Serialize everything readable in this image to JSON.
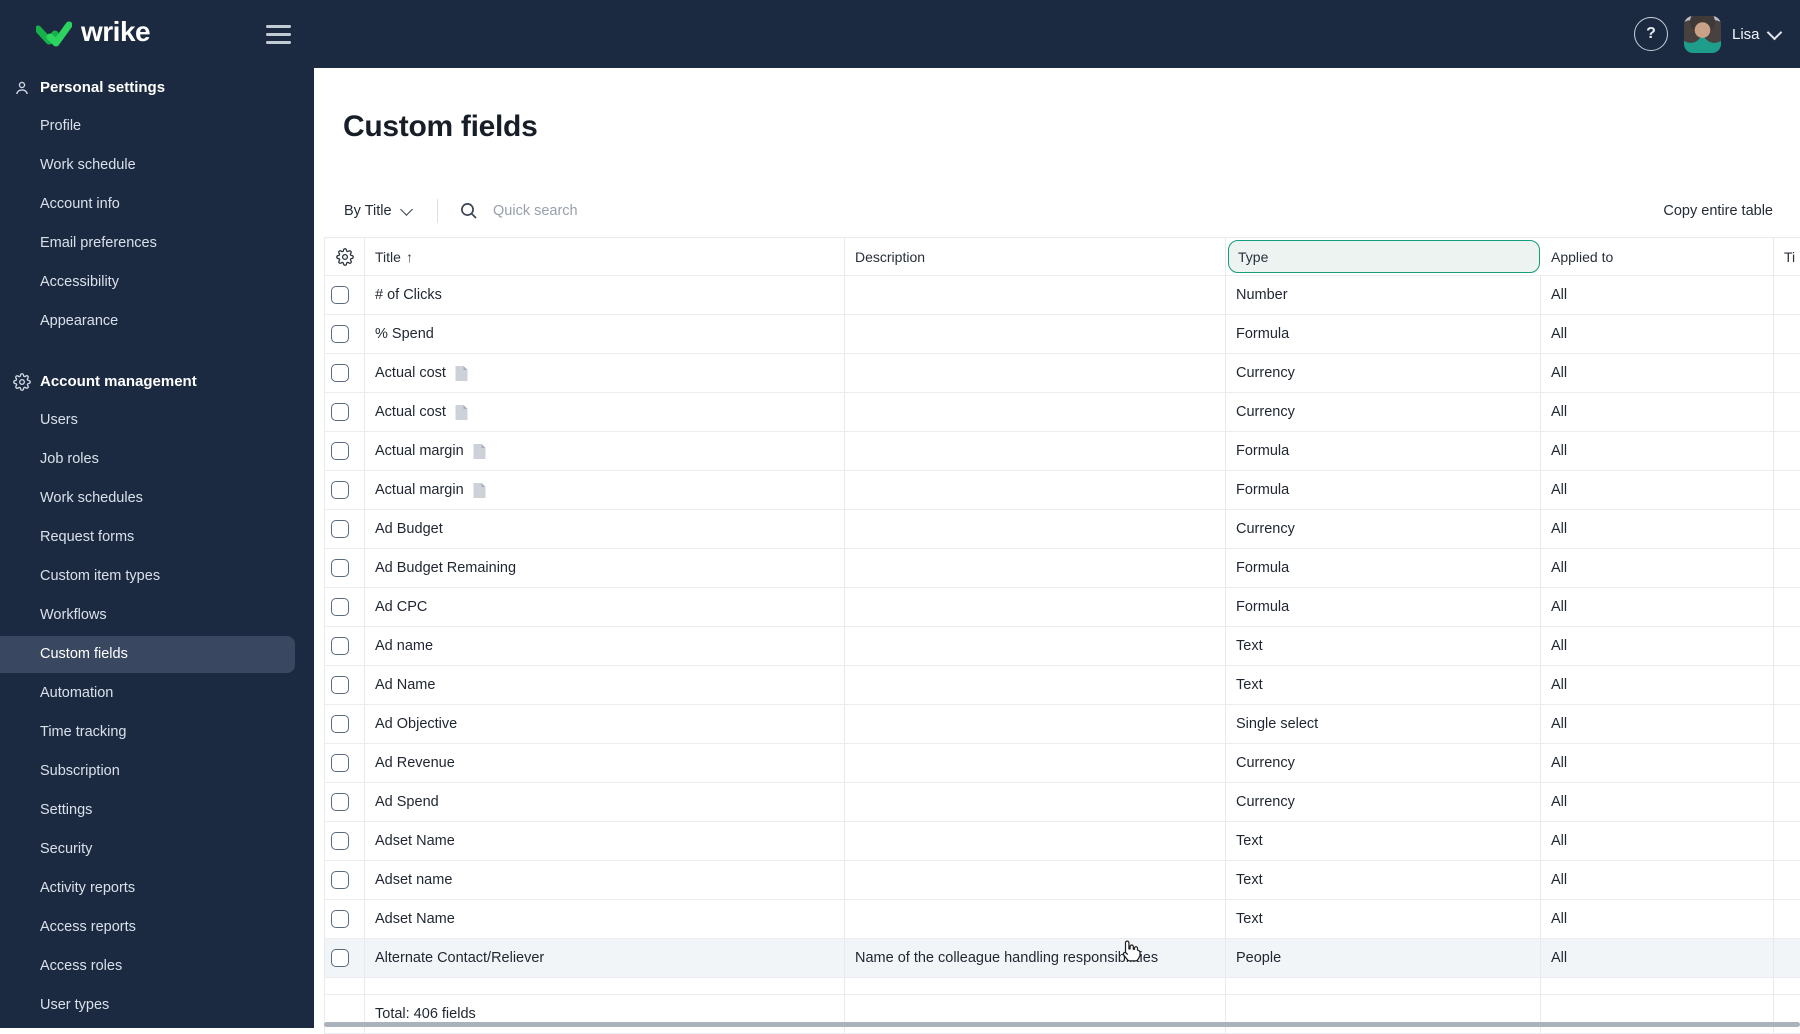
{
  "topbar": {
    "logo_text": "wrike",
    "help_glyph": "?",
    "user_name": "Lisa"
  },
  "icons": {
    "sort_asc": "↑"
  },
  "colors": {
    "topbar_bg": "#1b2a41",
    "sidebar_selected_bg": "#3a4760",
    "brand_green": "#21c95a",
    "type_highlight_border": "#149c7b",
    "type_highlight_bg": "#edf3f1",
    "hovered_row_bg": "#f1f5f8"
  },
  "sidebar": {
    "sections": [
      {
        "header": "Personal settings",
        "icon": "person-icon",
        "items": [
          {
            "label": "Profile",
            "selected": false
          },
          {
            "label": "Work schedule",
            "selected": false
          },
          {
            "label": "Account info",
            "selected": false
          },
          {
            "label": "Email preferences",
            "selected": false
          },
          {
            "label": "Accessibility",
            "selected": false
          },
          {
            "label": "Appearance",
            "selected": false
          }
        ]
      },
      {
        "header": "Account management",
        "icon": "gear-icon",
        "items": [
          {
            "label": "Users",
            "selected": false
          },
          {
            "label": "Job roles",
            "selected": false
          },
          {
            "label": "Work schedules",
            "selected": false
          },
          {
            "label": "Request forms",
            "selected": false
          },
          {
            "label": "Custom item types",
            "selected": false
          },
          {
            "label": "Workflows",
            "selected": false
          },
          {
            "label": "Custom fields",
            "selected": true
          },
          {
            "label": "Automation",
            "selected": false
          },
          {
            "label": "Time tracking",
            "selected": false
          },
          {
            "label": "Subscription",
            "selected": false
          },
          {
            "label": "Settings",
            "selected": false
          },
          {
            "label": "Security",
            "selected": false
          },
          {
            "label": "Activity reports",
            "selected": false
          },
          {
            "label": "Access reports",
            "selected": false
          },
          {
            "label": "Access roles",
            "selected": false
          },
          {
            "label": "User types",
            "selected": false
          }
        ]
      }
    ]
  },
  "main": {
    "title": "Custom fields",
    "toolbar": {
      "filter_label": "By Title",
      "search_placeholder": "Quick search",
      "copy_label": "Copy entire table"
    },
    "table": {
      "columns": [
        {
          "label": "Title",
          "sorted": "asc"
        },
        {
          "label": "Description"
        },
        {
          "label": "Type",
          "highlighted": true
        },
        {
          "label": "Applied to"
        },
        {
          "label": "Ti",
          "partial": true
        }
      ],
      "rows": [
        {
          "title": "# of Clicks",
          "description": "",
          "type": "Number",
          "applied_to": "All",
          "note_icon": false,
          "hovered": false
        },
        {
          "title": "% Spend",
          "description": "",
          "type": "Formula",
          "applied_to": "All",
          "note_icon": false,
          "hovered": false
        },
        {
          "title": "Actual cost",
          "description": "",
          "type": "Currency",
          "applied_to": "All",
          "note_icon": true,
          "hovered": false
        },
        {
          "title": "Actual cost",
          "description": "",
          "type": "Currency",
          "applied_to": "All",
          "note_icon": true,
          "hovered": false
        },
        {
          "title": "Actual margin",
          "description": "",
          "type": "Formula",
          "applied_to": "All",
          "note_icon": true,
          "hovered": false
        },
        {
          "title": "Actual margin",
          "description": "",
          "type": "Formula",
          "applied_to": "All",
          "note_icon": true,
          "hovered": false
        },
        {
          "title": "Ad Budget",
          "description": "",
          "type": "Currency",
          "applied_to": "All",
          "note_icon": false,
          "hovered": false
        },
        {
          "title": "Ad Budget Remaining",
          "description": "",
          "type": "Formula",
          "applied_to": "All",
          "note_icon": false,
          "hovered": false
        },
        {
          "title": "Ad CPC",
          "description": "",
          "type": "Formula",
          "applied_to": "All",
          "note_icon": false,
          "hovered": false
        },
        {
          "title": "Ad name",
          "description": "",
          "type": "Text",
          "applied_to": "All",
          "note_icon": false,
          "hovered": false
        },
        {
          "title": "Ad Name",
          "description": "",
          "type": "Text",
          "applied_to": "All",
          "note_icon": false,
          "hovered": false
        },
        {
          "title": "Ad Objective",
          "description": "",
          "type": "Single select",
          "applied_to": "All",
          "note_icon": false,
          "hovered": false
        },
        {
          "title": "Ad Revenue",
          "description": "",
          "type": "Currency",
          "applied_to": "All",
          "note_icon": false,
          "hovered": false
        },
        {
          "title": "Ad Spend",
          "description": "",
          "type": "Currency",
          "applied_to": "All",
          "note_icon": false,
          "hovered": false
        },
        {
          "title": "Adset Name",
          "description": "",
          "type": "Text",
          "applied_to": "All",
          "note_icon": false,
          "hovered": false
        },
        {
          "title": "Adset name",
          "description": "",
          "type": "Text",
          "applied_to": "All",
          "note_icon": false,
          "hovered": false
        },
        {
          "title": "Adset Name",
          "description": "",
          "type": "Text",
          "applied_to": "All",
          "note_icon": false,
          "hovered": false
        },
        {
          "title": "Alternate Contact/Reliever",
          "description": "Name of the colleague handling responsibilities",
          "type": "People",
          "applied_to": "All",
          "note_icon": false,
          "hovered": true
        }
      ],
      "total_label": "Total: 406 fields"
    }
  }
}
